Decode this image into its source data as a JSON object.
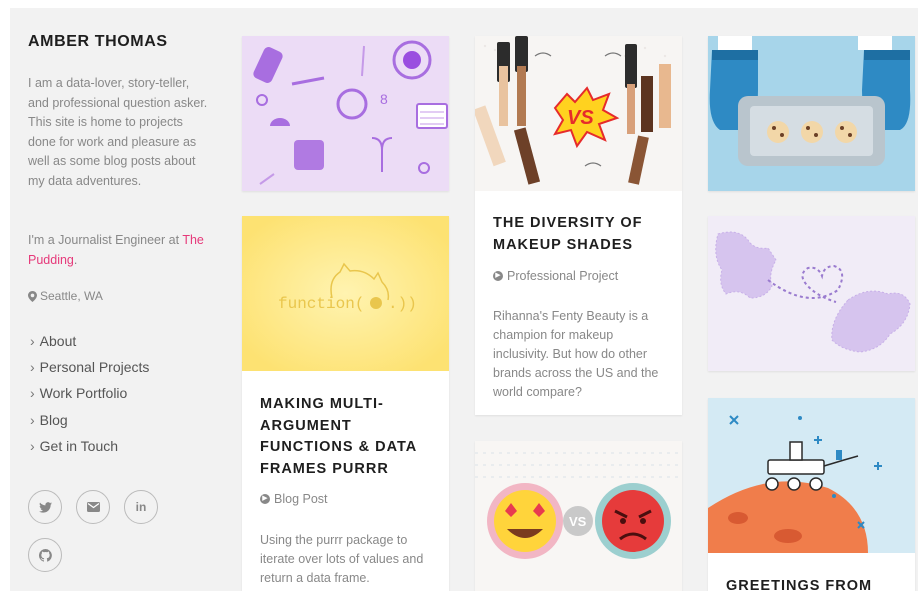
{
  "sidebar": {
    "name": "AMBER THOMAS",
    "bio": "I am a data-lover, story-teller, and professional question asker. This site is home to projects done for work and pleasure as well as some blog posts about my data adventures.",
    "job_prefix": "I'm a Journalist Engineer at",
    "job_link": "The Pudding",
    "job_suffix": ".",
    "location": "Seattle, WA",
    "nav": [
      "About",
      "Personal Projects",
      "Work Portfolio",
      "Blog",
      "Get in Touch"
    ],
    "socials": [
      {
        "label": "twitter",
        "icon": "twitter-icon"
      },
      {
        "label": "email",
        "icon": "envelope-icon"
      },
      {
        "label": "in",
        "icon": "linkedin-icon"
      },
      {
        "label": "github",
        "icon": "github-icon"
      }
    ]
  },
  "cards": [
    {
      "id": "period-tracker",
      "image": "period-products-illustration"
    },
    {
      "id": "purrr",
      "image": "cat-function-illustration",
      "title": "MAKING MULTI-ARGUMENT FUNCTIONS & DATA FRAMES PURRR",
      "type": "Blog Post",
      "desc": "Using the purrr package to iterate over lots of values and return a data frame."
    },
    {
      "id": "makeup",
      "image": "makeup-vs-illustration",
      "title": "THE DIVERSITY OF MAKEUP SHADES",
      "type": "Professional Project",
      "desc": "Rihanna's Fenty Beauty is a champion for makeup inclusivity. But how do other brands across the US and the world compare?"
    },
    {
      "id": "emoji",
      "image": "emoji-vs-illustration",
      "vs": "VS"
    },
    {
      "id": "cookies",
      "image": "oven-mitts-cookies-illustration"
    },
    {
      "id": "map",
      "image": "love-map-illustration"
    },
    {
      "id": "rover",
      "image": "mars-rover-illustration",
      "title": "GREETINGS FROM"
    }
  ],
  "colors": {
    "link": "#e6397a",
    "text": "#1e1e1e",
    "muted": "#888888",
    "background": "#f2f2f2"
  }
}
